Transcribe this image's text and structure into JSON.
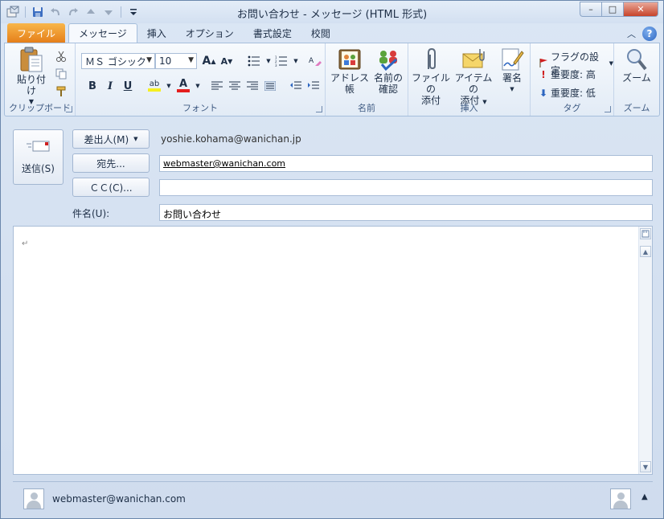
{
  "window": {
    "title": "お問い合わせ - メッセージ (HTML 形式)",
    "minimize": "–",
    "maximize": "□",
    "close": "✕"
  },
  "qat": {
    "app_icon": "outlook-app-icon",
    "save_icon": "save-icon",
    "undo_icon": "undo-icon",
    "redo_icon": "redo-icon",
    "prev_icon": "up-arrow-icon",
    "next_icon": "down-arrow-icon",
    "customize_icon": "customize-qat-icon"
  },
  "tabs": [
    {
      "label": "ファイル"
    },
    {
      "label": "メッセージ"
    },
    {
      "label": "挿入"
    },
    {
      "label": "オプション"
    },
    {
      "label": "書式設定"
    },
    {
      "label": "校閲"
    }
  ],
  "ribbon": {
    "clipboard": {
      "paste_label": "貼り付け",
      "group_label": "クリップボード"
    },
    "font": {
      "font_name": "ＭＳ ゴシック",
      "font_size": "10",
      "bold": "B",
      "italic": "I",
      "underline": "U",
      "grow": "A",
      "shrink": "A",
      "font_color": "A",
      "highlight": "ab",
      "group_label": "フォント"
    },
    "names": {
      "address_book": "アドレス帳",
      "check_names_line1": "名前の",
      "check_names_line2": "確認",
      "group_label": "名前"
    },
    "include": {
      "attach_file_line1": "ファイルの",
      "attach_file_line2": "添付",
      "attach_item_line1": "アイテムの",
      "attach_item_line2": "添付",
      "signature": "署名",
      "group_label": "挿入"
    },
    "tags": {
      "follow_up": "フラグの設定",
      "high_importance": "重要度: 高",
      "low_importance": "重要度: 低",
      "group_label": "タグ"
    },
    "zoom": {
      "zoom_label": "ズーム",
      "group_label": "ズーム"
    }
  },
  "compose": {
    "send_label": "送信(S)",
    "from_button": "差出人(M)",
    "from_value": "yoshie.kohama@wanichan.jp",
    "to_button": "宛先...",
    "to_value": "webmaster@wanichan.com",
    "cc_button": "ＣＣ(C)...",
    "cc_value": "",
    "subject_label": "件名(U):",
    "subject_value": "お問い合わせ",
    "body_mark": "↵"
  },
  "people_pane": {
    "contact": "webmaster@wanichan.com"
  },
  "colors": {
    "file_tab": "#e57f1a",
    "accent": "#1e395b",
    "flag_red": "#d02020",
    "importance_high": "#d02020",
    "importance_low": "#2d66c1"
  }
}
